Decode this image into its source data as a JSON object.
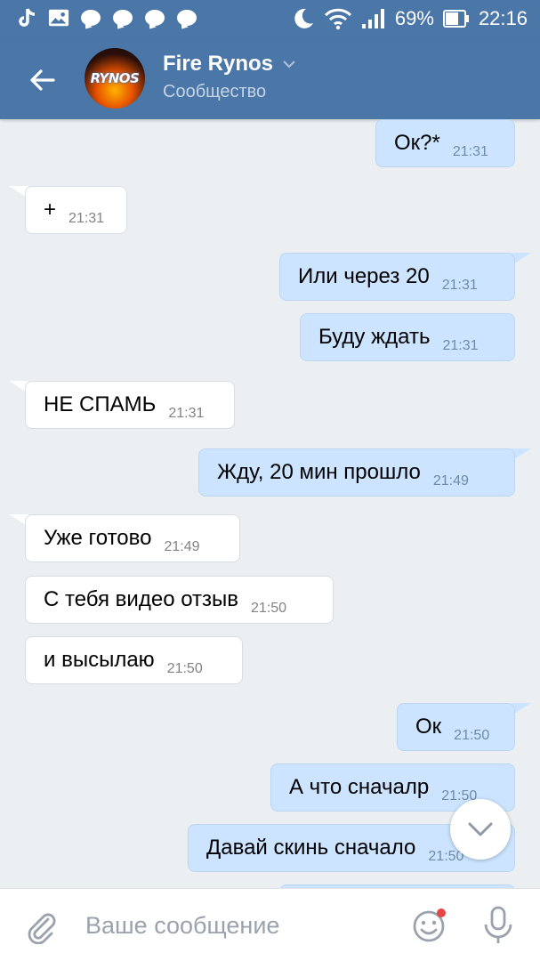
{
  "status_bar": {
    "battery_percent": "69%",
    "time": "22:16"
  },
  "header": {
    "title": "Fire Rynos",
    "subtitle": "Сообщество",
    "avatar_text": "RYNOS"
  },
  "messages": [
    {
      "side": "out",
      "text": "Ок?*",
      "time": "21:31"
    },
    {
      "side": "in",
      "text": "+",
      "time": "21:31"
    },
    {
      "side": "out",
      "text": "Или через 20",
      "time": "21:31"
    },
    {
      "side": "out",
      "text": "Буду ждать",
      "time": "21:31"
    },
    {
      "side": "in",
      "text": "НЕ СПАМЬ",
      "time": "21:31"
    },
    {
      "side": "out",
      "text": "Жду, 20 мин прошло",
      "time": "21:49"
    },
    {
      "side": "in",
      "text": "Уже готово",
      "time": "21:49"
    },
    {
      "side": "in",
      "text": "С тебя видео отзыв",
      "time": "21:50"
    },
    {
      "side": "in",
      "text": "и высылаю",
      "time": "21:50"
    },
    {
      "side": "out",
      "text": "Ок",
      "time": "21:50"
    },
    {
      "side": "out",
      "text": "А что сначалр",
      "time": "21:50"
    },
    {
      "side": "out",
      "text": "Давай скинь сначало",
      "time": "21:50"
    }
  ],
  "composer": {
    "placeholder": "Ваше сообщение"
  },
  "colors": {
    "header_bg": "#4a76a8",
    "chat_bg": "#ebeff2",
    "incoming_bubble": "#ffffff",
    "outgoing_bubble": "#cce4ff",
    "icon_blue": "#5181b8",
    "notification_dot": "#e64646"
  },
  "icons": [
    "tiktok-icon",
    "gallery-icon",
    "chat-bubble-icon",
    "moon-icon",
    "wifi-icon",
    "signal-icon",
    "battery-icon",
    "back-arrow-icon",
    "chevron-down-icon",
    "attach-icon",
    "emoji-icon",
    "mic-icon"
  ]
}
